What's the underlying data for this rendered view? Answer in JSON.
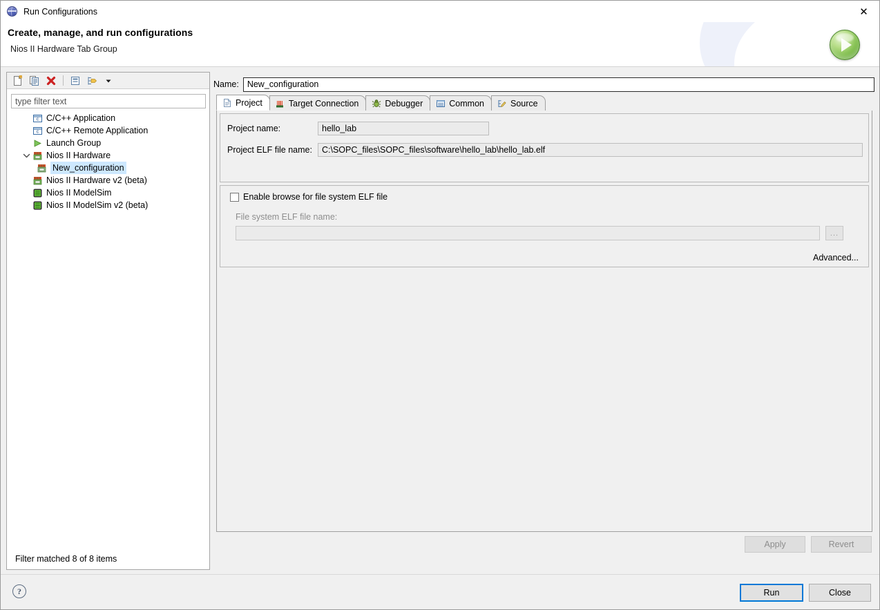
{
  "window": {
    "title": "Run Configurations",
    "icon": "globe-icon",
    "close_label": "✕"
  },
  "header": {
    "title": "Create, manage, and run configurations",
    "subtitle": "Nios II Hardware Tab Group",
    "run_icon": "run-green-ball-icon"
  },
  "left_panel": {
    "toolbar": [
      {
        "name": "new-launch-configuration-icon",
        "tooltip": "New launch configuration"
      },
      {
        "name": "duplicate-configuration-icon",
        "tooltip": "Duplicate"
      },
      {
        "name": "delete-configuration-icon",
        "tooltip": "Delete"
      },
      {
        "name": "collapse-all-icon",
        "tooltip": "Collapse All"
      },
      {
        "name": "filter-launch-configurations-icon",
        "tooltip": "Filter"
      },
      {
        "name": "view-menu-chevron-icon",
        "tooltip": "View Menu"
      }
    ],
    "filter": {
      "value": "",
      "placeholder": "type filter text"
    },
    "tree": [
      {
        "label": "C/C++ Application",
        "icon": "cpp-application-icon",
        "indent": 0,
        "twisty": "",
        "selected": false
      },
      {
        "label": "C/C++ Remote Application",
        "icon": "cpp-application-icon",
        "indent": 0,
        "twisty": "",
        "selected": false
      },
      {
        "label": "Launch Group",
        "icon": "launch-group-icon",
        "indent": 0,
        "twisty": "",
        "selected": false
      },
      {
        "label": "Nios II Hardware",
        "icon": "nios-hardware-icon",
        "indent": 0,
        "twisty": "expanded",
        "selected": false
      },
      {
        "label": "New_configuration",
        "icon": "nios-hardware-icon",
        "indent": 1,
        "twisty": "",
        "selected": true
      },
      {
        "label": "Nios II Hardware v2 (beta)",
        "icon": "nios-hardware-icon",
        "indent": 0,
        "twisty": "",
        "selected": false
      },
      {
        "label": "Nios II ModelSim",
        "icon": "nios-modelsim-icon",
        "indent": 0,
        "twisty": "",
        "selected": false
      },
      {
        "label": "Nios II ModelSim v2 (beta)",
        "icon": "nios-modelsim-icon",
        "indent": 0,
        "twisty": "",
        "selected": false
      }
    ],
    "status": "Filter matched 8 of 8 items"
  },
  "right_panel": {
    "name_label": "Name:",
    "name_value": "New_configuration",
    "tabs": [
      {
        "label": "Project",
        "icon": "project-file-icon",
        "active": true
      },
      {
        "label": "Target Connection",
        "icon": "target-connection-icon",
        "active": false
      },
      {
        "label": "Debugger",
        "icon": "debugger-bug-icon",
        "active": false
      },
      {
        "label": "Common",
        "icon": "common-list-icon",
        "active": false
      },
      {
        "label": "Source",
        "icon": "source-edit-icon",
        "active": false
      }
    ],
    "project_group": {
      "project_name_label": "Project name:",
      "project_name_value": "hello_lab",
      "elf_label": "Project ELF file name:",
      "elf_value": "C:\\SOPC_files\\SOPC_files\\software\\hello_lab\\hello_lab.elf"
    },
    "filesystem_group": {
      "checkbox_label": "Enable browse for file system ELF file",
      "checkbox_checked": false,
      "fs_elf_label": "File system ELF file name:",
      "fs_elf_value": "",
      "browse_label": "...",
      "advanced_label": "Advanced..."
    },
    "apply_label": "Apply",
    "revert_label": "Revert",
    "apply_enabled": false,
    "revert_enabled": false
  },
  "footer": {
    "help_label": "?",
    "run_label": "Run",
    "close_label": "Close"
  },
  "colors": {
    "selection_blue": "#cde8ff",
    "primary_border": "#0078d7",
    "panel_bg": "#f0f0f0",
    "run_green": "#7dbc4a",
    "delete_red": "#cc2222"
  }
}
